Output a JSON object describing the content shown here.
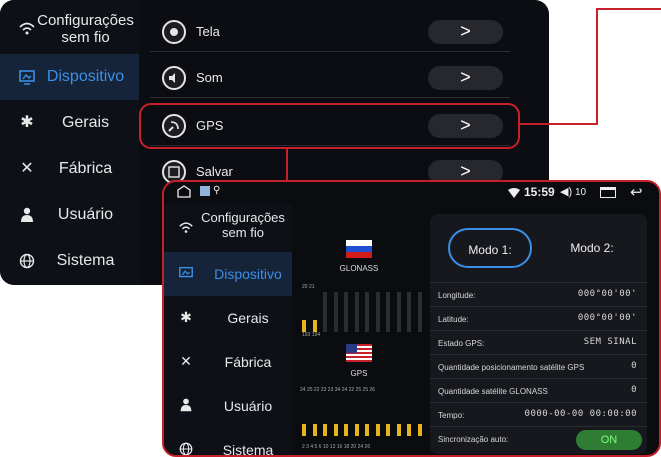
{
  "back": {
    "sidebar": [
      {
        "label": "Configurações sem fio",
        "icon": "wifi-icon"
      },
      {
        "label": "Dispositivo",
        "icon": "device-icon",
        "active": true
      },
      {
        "label": "Gerais",
        "icon": "gear-icon"
      },
      {
        "label": "Fábrica",
        "icon": "tools-icon"
      },
      {
        "label": "Usuário",
        "icon": "user-icon"
      },
      {
        "label": "Sistema",
        "icon": "globe-icon"
      }
    ],
    "rows": [
      {
        "label": "Tela",
        "icon": "display-icon"
      },
      {
        "label": "Som",
        "icon": "speaker-icon"
      },
      {
        "label": "GPS",
        "icon": "satellite-icon"
      },
      {
        "label": "Salvar",
        "icon": "save-icon"
      }
    ],
    "chevron": ">"
  },
  "front": {
    "status": {
      "time": "15:59",
      "volume": "10"
    },
    "sidebar": [
      {
        "label": "Configurações sem fio"
      },
      {
        "label": "Dispositivo",
        "active": true
      },
      {
        "label": "Gerais"
      },
      {
        "label": "Fábrica"
      },
      {
        "label": "Usuário"
      },
      {
        "label": "Sistema"
      }
    ],
    "glonass": {
      "label": "GLONASS",
      "ticks": "20  21"
    },
    "gps": {
      "label": "GPS",
      "ticks_small": "193 194",
      "ticks_top": "24  25  22  23  23  34  24  22  25  25  26",
      "ticks_bottom": "2   3   4   5   6   10  13  16  18  20  24  26"
    },
    "modes": {
      "mode1": "Modo 1:",
      "mode2": "Modo 2:"
    },
    "info": [
      {
        "key": "Longitude:",
        "value": "000°00'00'"
      },
      {
        "key": "Latitude:",
        "value": "000°00'00'"
      },
      {
        "key": "Estado GPS:",
        "value": "SEM SINAL"
      },
      {
        "key": "Quantidade posicionamento satélite GPS",
        "value": "0"
      },
      {
        "key": "Quantidade satélite GLONASS",
        "value": "0"
      },
      {
        "key": "Tempo:",
        "value": "0000-00-00 00:00:00"
      },
      {
        "key": "Sincronização auto:",
        "value": "ON"
      }
    ]
  },
  "colors": {
    "accent": "#3a8fe6",
    "highlight": "#c8202a",
    "bar_on": "#e9b31c",
    "toggle_on": "#2e7d32"
  }
}
